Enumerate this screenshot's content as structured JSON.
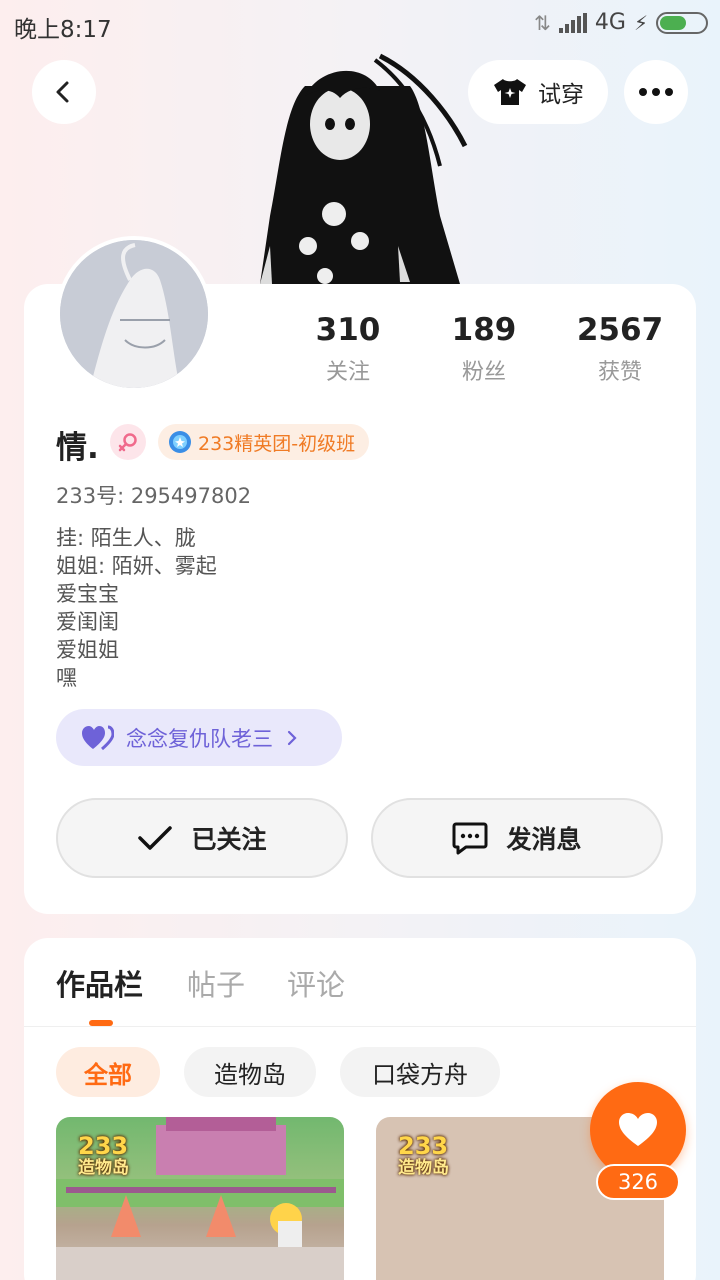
{
  "status_bar": {
    "time": "晚上8:17",
    "network": "4G"
  },
  "header": {
    "try_on_label": "试穿"
  },
  "stats": [
    {
      "num": "310",
      "label": "关注"
    },
    {
      "num": "189",
      "label": "粉丝"
    },
    {
      "num": "2567",
      "label": "获赞"
    }
  ],
  "profile": {
    "name": "情.",
    "badge": "233精英团-初级班",
    "uid": "233号: 295497802",
    "bio": [
      "挂: 陌生人、胧",
      "姐姐: 陌妍、雾起",
      "爱宝宝",
      "爱闺闺",
      "爱姐姐",
      "嘿"
    ],
    "guild": "念念复仇队老三"
  },
  "actions": {
    "follow_label": "已关注",
    "message_label": "发消息"
  },
  "tabs": [
    "作品栏",
    "帖子",
    "评论"
  ],
  "filters": [
    "全部",
    "造物岛",
    "口袋方舟"
  ],
  "works": [
    {
      "logo_top": "233",
      "logo_bottom": "造物岛"
    },
    {
      "logo_top": "233",
      "logo_bottom": "造物岛"
    }
  ],
  "like": {
    "count": "326"
  },
  "colors": {
    "accent": "#ff6a13",
    "guild": "#6e62d8",
    "badge_text": "#f07b25"
  }
}
